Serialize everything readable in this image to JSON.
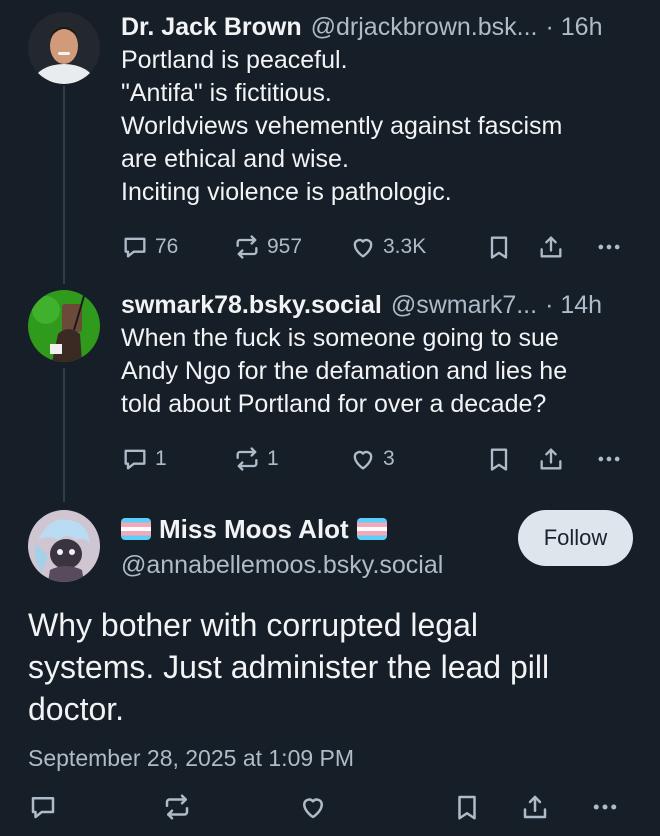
{
  "posts": [
    {
      "name": "Dr. Jack Brown",
      "handle": "@drjackbrown.bsk...",
      "time": "· 16h",
      "lines": [
        "Portland is peaceful.",
        "\"Antifa\" is fictitious.",
        "Worldviews vehemently against fascism",
        "are ethical and wise.",
        "Inciting violence is pathologic."
      ],
      "replies": "76",
      "reposts": "957",
      "likes": "3.3K"
    },
    {
      "name": "swmark78.bsky.social",
      "handle": "@swmark7...",
      "time": "· 14h",
      "lines": [
        "When the fuck is someone going to sue",
        "Andy Ngo for the defamation and lies he",
        "told about Portland for over a decade?"
      ],
      "replies": "1",
      "reposts": "1",
      "likes": "3"
    }
  ],
  "main": {
    "name": "Miss Moos Alot",
    "handle": "@annabellemoos.bsky.social",
    "follow_label": "Follow",
    "lines": [
      "Why bother with corrupted legal",
      "systems. Just administer the lead pill",
      "doctor."
    ],
    "timestamp": "September 28, 2025 at 1:09 PM"
  },
  "icons": {
    "reply": "reply-bubble-icon",
    "repost": "repost-arrows-icon",
    "like": "heart-icon",
    "bookmark": "bookmark-icon",
    "share": "share-upload-icon",
    "more": "ellipsis-icon",
    "flag": "transgender-flag-emoji"
  },
  "colors": {
    "background": "#161e27",
    "text": "#f1f3f5",
    "muted": "#aebbc9",
    "thread_line": "#2e3c4b",
    "follow_bg": "#dfe5ec"
  }
}
